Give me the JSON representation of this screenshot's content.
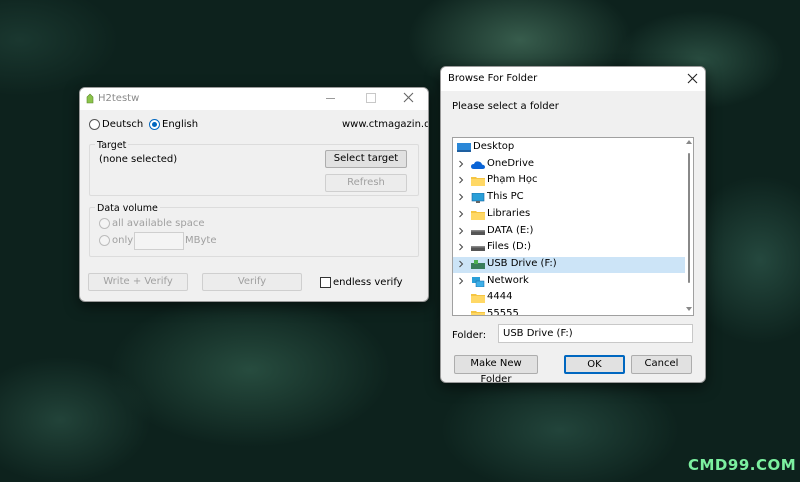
{
  "h2testw": {
    "title": "H2testw",
    "lang_deutsch": "Deutsch",
    "lang_english": "English",
    "website": "www.ctmagazin.de",
    "target_label": "Target",
    "target_value": "(none selected)",
    "select_target": "Select target",
    "refresh": "Refresh",
    "data_volume_label": "Data volume",
    "all_space": "all available space",
    "only": "only",
    "mbyte": "MByte",
    "write_verify": "Write + Verify",
    "verify": "Verify",
    "endless_verify": "endless verify"
  },
  "browse": {
    "title": "Browse For Folder",
    "prompt": "Please select a folder",
    "tree": [
      {
        "label": "Desktop",
        "icon": "desktop-icon",
        "chevron": false,
        "selected": false
      },
      {
        "label": "OneDrive",
        "icon": "cloud-icon",
        "chevron": true,
        "selected": false
      },
      {
        "label": "Phạm Học",
        "icon": "folder-icon",
        "chevron": true,
        "selected": false
      },
      {
        "label": "This PC",
        "icon": "monitor-icon",
        "chevron": true,
        "selected": false
      },
      {
        "label": "Libraries",
        "icon": "folder-icon",
        "chevron": true,
        "selected": false
      },
      {
        "label": "DATA (E:)",
        "icon": "drive-icon",
        "chevron": true,
        "selected": false
      },
      {
        "label": "Files (D:)",
        "icon": "drive-icon",
        "chevron": true,
        "selected": false
      },
      {
        "label": "USB Drive (F:)",
        "icon": "usb-drive-icon",
        "chevron": true,
        "selected": true
      },
      {
        "label": "Network",
        "icon": "network-icon",
        "chevron": true,
        "selected": false
      },
      {
        "label": "4444",
        "icon": "folder-icon",
        "chevron": false,
        "selected": false
      },
      {
        "label": "55555",
        "icon": "folder-icon",
        "chevron": false,
        "selected": false
      }
    ],
    "folder_label": "Folder:",
    "folder_value": "USB Drive (F:)",
    "make_new_folder": "Make New Folder",
    "ok": "OK",
    "cancel": "Cancel"
  },
  "watermark": "CMD99.COM",
  "colors": {
    "accent": "#0067c0",
    "selection": "#cce4f7",
    "watermark": "#7cf0a0"
  }
}
